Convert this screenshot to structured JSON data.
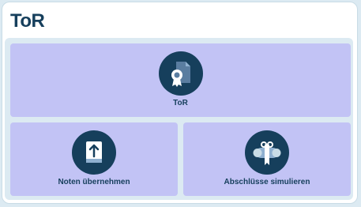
{
  "page": {
    "title": "ToR"
  },
  "tiles": [
    {
      "label": "ToR",
      "icon": "certificate-document-icon"
    },
    {
      "label": "Noten übernehmen",
      "icon": "upload-book-icon"
    },
    {
      "label": "Abschlüsse simulieren",
      "icon": "diploma-scroll-icon"
    }
  ],
  "colors": {
    "background": "#dceaf2",
    "card": "#ffffff",
    "tile": "#c2c3f5",
    "accent": "#163f5c"
  }
}
